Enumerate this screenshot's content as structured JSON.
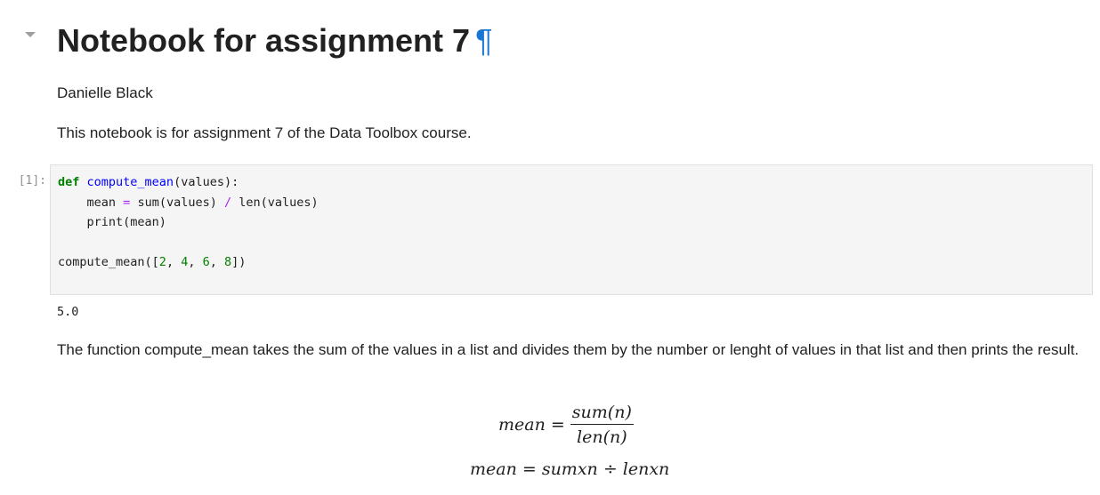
{
  "heading": {
    "title": "Notebook for assignment 7",
    "anchor": "¶"
  },
  "markdown": {
    "author": "Danielle Black",
    "intro": "This notebook is for assignment 7 of the Data Toolbox course.",
    "explanation": "The function compute_mean takes the sum of the values in a list and divides them by the number or lenght of values in that list and then prints the result."
  },
  "code_cell": {
    "prompt": "[1]:",
    "source": {
      "def_kw": "def",
      "fn_name": "compute_mean",
      "params": "(values):",
      "line2_indent": "    ",
      "line2_var": "mean",
      "line2_eq": "=",
      "line2_rhs_a": "sum(values)",
      "line2_div": "/",
      "line2_rhs_b": "len(values)",
      "line3": "    print(mean)",
      "call_name": "compute_mean([",
      "call_args": [
        "2",
        "4",
        "6",
        "8"
      ],
      "call_sep": ", ",
      "call_close": "])"
    },
    "output": "5.0"
  },
  "equations": {
    "eq1": {
      "lhs": "mean =",
      "numerator": "sum(n)",
      "denominator": "len(n)"
    },
    "eq2": "mean = sumxn ÷ lenxn"
  }
}
